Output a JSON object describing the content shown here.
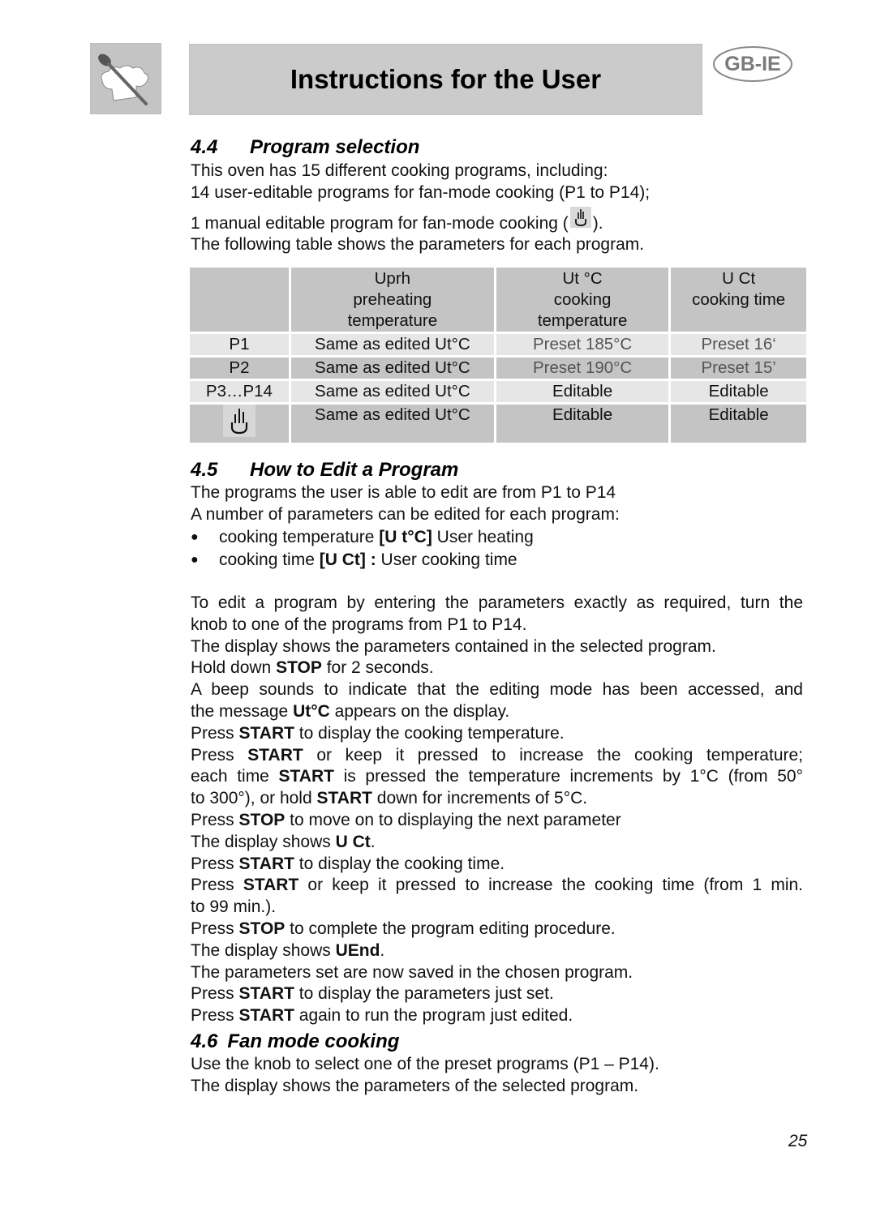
{
  "header": {
    "logo_icon": "chef-hat-spoon-icon",
    "title": "Instructions for the User",
    "language_badge": "GB-IE"
  },
  "section_4_4": {
    "number": "4.4",
    "title": "Program selection",
    "lines": [
      "This oven has 15 different cooking programs, including:",
      "14 user-editable programs for fan-mode cooking (P1 to P14);",
      "1 manual editable program for fan-mode cooking (",
      ").",
      "The following table shows the parameters for each program."
    ],
    "manual_icon": "manual-hand-icon"
  },
  "table": {
    "headers": [
      {
        "lines": [
          "",
          "",
          ""
        ]
      },
      {
        "lines": [
          "Uprh",
          "preheating",
          "temperature"
        ]
      },
      {
        "lines": [
          "Ut °C",
          "cooking",
          "temperature"
        ]
      },
      {
        "lines": [
          "U Ct",
          "cooking time",
          ""
        ]
      }
    ],
    "rows": [
      {
        "program": "P1",
        "preheat": "Same as edited Ut°C",
        "temp": "Preset 185°C",
        "time": "Preset 16‘"
      },
      {
        "program": "P2",
        "preheat": "Same as edited Ut°C",
        "temp": "Preset 190°C",
        "time": "Preset 15’"
      },
      {
        "program": "P3…P14",
        "preheat": "Same as edited Ut°C",
        "temp": "Editable",
        "time": "Editable"
      },
      {
        "program_icon": "manual-hand-icon",
        "preheat": "Same as edited Ut°C",
        "temp": "Editable",
        "time": "Editable"
      }
    ]
  },
  "section_4_5": {
    "number": "4.5",
    "title": "How to Edit a Program",
    "intro": [
      "The programs the user is able to edit are from P1 to P14",
      "A number of parameters can be edited for each program:"
    ],
    "bullets": [
      {
        "pre": "cooking temperature ",
        "bold": "[U t°C]",
        "post": " User heating"
      },
      {
        "pre": "cooking time ",
        "bold": "[U Ct] :",
        "post": " User cooking time"
      }
    ],
    "steps": {
      "s1a": "To edit a program by entering the parameters exactly as required, turn the",
      "s1b": "knob to one of the programs from P1 to P14.",
      "s2": "The display shows the parameters contained in the selected program.",
      "s3_pre": "Hold down ",
      "s3_bold": "STOP",
      "s3_post": " for 2 seconds.",
      "s4a": "A beep sounds to indicate that the editing mode has been accessed, and",
      "s4b_pre": "the message ",
      "s4b_bold": "Ut°C",
      "s4b_post": " appears on the display.",
      "s5_pre": "Press ",
      "s5_bold": "START",
      "s5_post": " to display the cooking temperature.",
      "s6a_pre": "Press ",
      "s6a_bold": "START",
      "s6a_post": " or keep it pressed to increase the cooking temperature;",
      "s6b_pre": "each time ",
      "s6b_bold": "START",
      "s6b_post": " is pressed the temperature increments by 1°C (from 50°",
      "s6c_pre": "to 300°), or hold ",
      "s6c_bold": "START",
      "s6c_post": " down for increments of 5°C.",
      "s7_pre": "Press ",
      "s7_bold": "STOP",
      "s7_post": " to move on to displaying the next parameter",
      "s8_pre": "The display shows ",
      "s8_bold": "U Ct",
      "s8_post": ".",
      "s9_pre": "Press ",
      "s9_bold": "START",
      "s9_post": " to display the cooking time.",
      "s10a_pre": "Press ",
      "s10a_bold": "START",
      "s10a_post": " or keep it pressed to increase the cooking time (from 1 min.",
      "s10b": "to 99 min.).",
      "s11_pre": "Press ",
      "s11_bold": "STOP",
      "s11_post": " to complete the program editing procedure.",
      "s12_pre": "The display shows ",
      "s12_bold": "UEnd",
      "s12_post": ".",
      "s13": "The parameters set are now saved in the chosen program.",
      "s14_pre": "Press ",
      "s14_bold": "START",
      "s14_post": " to display the parameters just set.",
      "s15_pre": "Press ",
      "s15_bold": "START",
      "s15_post": " again to run the program just edited."
    }
  },
  "section_4_6": {
    "number": "4.6",
    "title": "Fan mode cooking",
    "lines": [
      "Use the knob to select one of the preset programs (P1 – P14).",
      "The display shows the parameters of the selected program."
    ]
  },
  "page_number": "25"
}
